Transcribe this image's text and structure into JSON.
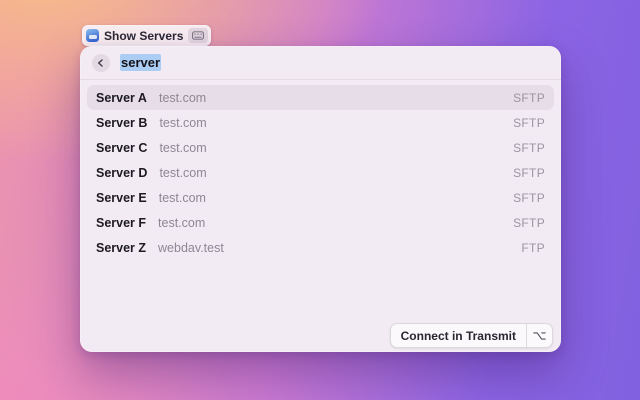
{
  "colors": {
    "bg_peach": "#f6bd88",
    "bg_pink": "#ee8fbe",
    "bg_purple": "#8161df",
    "panel_bg": "#f3ebf4",
    "row_selected_bg": "#e6dde8",
    "text_primary": "#1d1a21",
    "text_secondary": "#8e8794",
    "text_selection_highlight": "#accdf3"
  },
  "header_badge": {
    "app_icon": "transmit-app-icon",
    "label": "Show Servers",
    "shortcut_icon": "keyboard-icon"
  },
  "panel": {
    "search": {
      "back_icon": "chevron-left-icon",
      "value": "server",
      "value_selected": true
    },
    "server_list": [
      {
        "name": "Server A",
        "host": "test.com",
        "protocol": "SFTP",
        "selected": true
      },
      {
        "name": "Server B",
        "host": "test.com",
        "protocol": "SFTP",
        "selected": false
      },
      {
        "name": "Server C",
        "host": "test.com",
        "protocol": "SFTP",
        "selected": false
      },
      {
        "name": "Server D",
        "host": "test.com",
        "protocol": "SFTP",
        "selected": false
      },
      {
        "name": "Server E",
        "host": "test.com",
        "protocol": "SFTP",
        "selected": false
      },
      {
        "name": "Server F",
        "host": "test.com",
        "protocol": "SFTP",
        "selected": false
      },
      {
        "name": "Server Z",
        "host": "webdav.test",
        "protocol": "FTP",
        "selected": false
      }
    ],
    "footer": {
      "connect_label": "Connect in Transmit",
      "modifier_icon": "option-key-icon"
    }
  }
}
